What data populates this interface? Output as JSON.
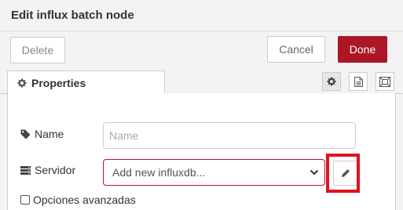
{
  "header": {
    "title": "Edit influx batch node"
  },
  "toolbar": {
    "delete_label": "Delete",
    "cancel_label": "Cancel",
    "done_label": "Done"
  },
  "tabs": {
    "properties_label": "Properties",
    "icons": [
      "gear-icon",
      "document-icon",
      "frame-icon"
    ]
  },
  "form": {
    "name_label": "Name",
    "name_placeholder": "Name",
    "name_value": "",
    "server_label": "Servidor",
    "server_selected": "Add new influxdb...",
    "advanced_label": "Opciones avanzadas",
    "advanced_checked": false
  },
  "colors": {
    "primary": "#ad1625",
    "highlight": "#e0121f",
    "border": "#cccccc"
  }
}
